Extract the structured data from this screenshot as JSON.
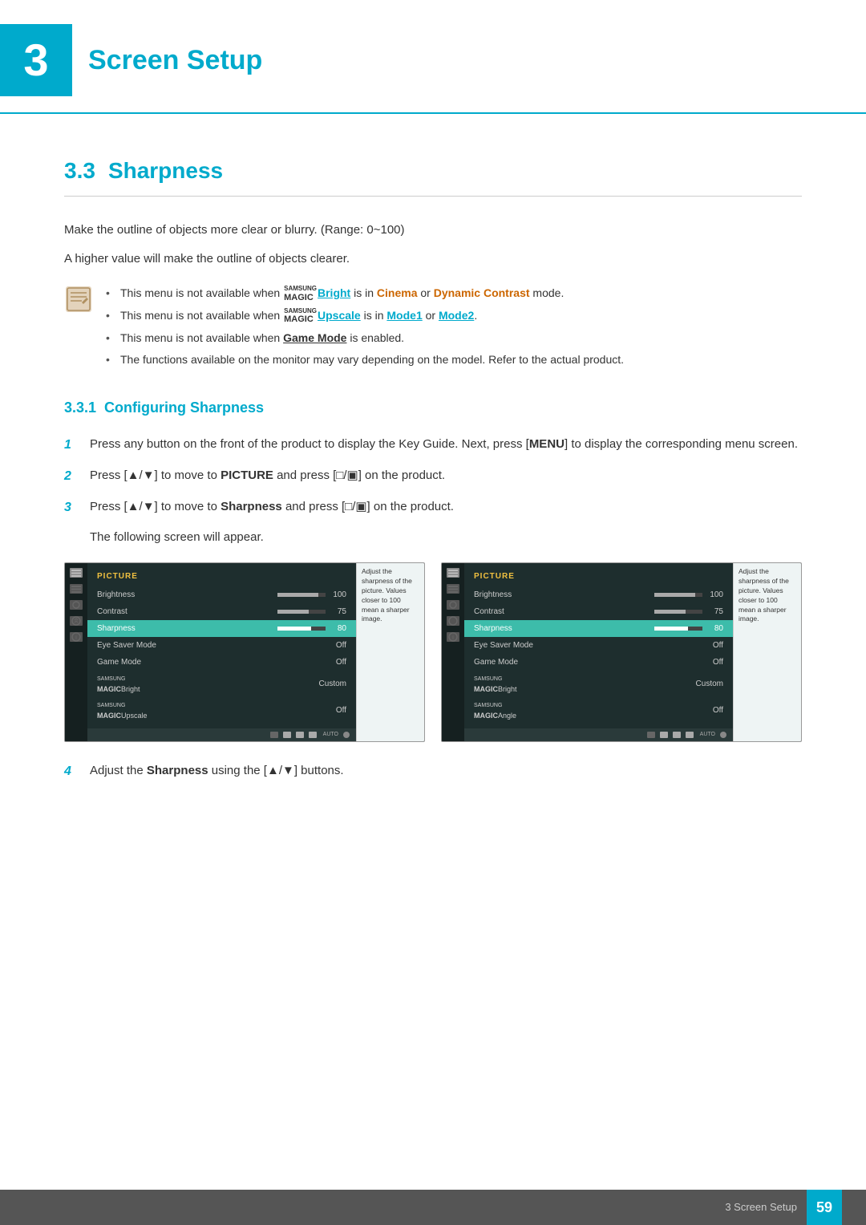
{
  "chapter": {
    "number": "3",
    "title": "Screen Setup"
  },
  "section": {
    "number": "3.3",
    "title": "Sharpness",
    "description1": "Make the outline of objects more clear or blurry. (Range: 0~100)",
    "description2": "A higher value will make the outline of objects clearer.",
    "notes": [
      {
        "id": 1,
        "parts": [
          {
            "text": "This menu is not available when ",
            "type": "normal"
          },
          {
            "text": "SAMSUNG",
            "type": "brand-top"
          },
          {
            "text": "MAGIC",
            "type": "brand-magic"
          },
          {
            "text": "Bright",
            "type": "highlight-blue"
          },
          {
            "text": " is in ",
            "type": "normal"
          },
          {
            "text": "Cinema",
            "type": "highlight-orange"
          },
          {
            "text": " or ",
            "type": "normal"
          },
          {
            "text": "Dynamic Contrast",
            "type": "highlight-orange"
          },
          {
            "text": " mode.",
            "type": "normal"
          }
        ]
      },
      {
        "id": 2,
        "parts": [
          {
            "text": "This menu is not available when ",
            "type": "normal"
          },
          {
            "text": "SAMSUNG",
            "type": "brand-top"
          },
          {
            "text": "MAGIC",
            "type": "brand-magic"
          },
          {
            "text": "Upscale",
            "type": "highlight-blue"
          },
          {
            "text": " is in ",
            "type": "normal"
          },
          {
            "text": "Mode1",
            "type": "highlight-blue"
          },
          {
            "text": " or ",
            "type": "normal"
          },
          {
            "text": "Mode2",
            "type": "highlight-blue"
          },
          {
            "text": ".",
            "type": "normal"
          }
        ]
      },
      {
        "id": 3,
        "parts": [
          {
            "text": "This menu is not available when ",
            "type": "normal"
          },
          {
            "text": "Game Mode",
            "type": "highlight-bold"
          },
          {
            "text": " is enabled.",
            "type": "normal"
          }
        ]
      },
      {
        "id": 4,
        "parts": [
          {
            "text": "The functions available on the monitor may vary depending on the model. Refer to the actual product.",
            "type": "normal"
          }
        ]
      }
    ],
    "subsection": {
      "number": "3.3.1",
      "title": "Configuring Sharpness"
    },
    "steps": [
      {
        "num": "1",
        "text": "Press any button on the front of the product to display the Key Guide. Next, press [",
        "bold_mid": "MENU",
        "text2": "] to display the corresponding menu screen."
      },
      {
        "num": "2",
        "text": "Press [▲/▼] to move to ",
        "bold_mid": "PICTURE",
        "text2": " and press [□/▣] on the product."
      },
      {
        "num": "3",
        "text": "Press [▲/▼] to move to ",
        "bold_mid": "Sharpness",
        "text2": " and press [□/▣] on the product."
      }
    ],
    "step3_subtext": "The following screen will appear.",
    "step4_text": "Adjust the ",
    "step4_bold": "Sharpness",
    "step4_text2": " using the [▲/▼] buttons."
  },
  "monitor1": {
    "header": "PICTURE",
    "items": [
      {
        "name": "Brightness",
        "value": "100",
        "bar": 85,
        "active": false
      },
      {
        "name": "Contrast",
        "value": "75",
        "bar": 65,
        "active": false
      },
      {
        "name": "Sharpness",
        "value": "80",
        "bar": 70,
        "active": true
      },
      {
        "name": "Eye Saver Mode",
        "value": "Off",
        "bar": 0,
        "active": false
      },
      {
        "name": "Game Mode",
        "value": "Off",
        "bar": 0,
        "active": false
      },
      {
        "name": "MAGICBright",
        "value": "Custom",
        "bar": 0,
        "active": false
      },
      {
        "name": "MAGICUpscale",
        "value": "Off",
        "bar": 0,
        "active": false
      }
    ],
    "tooltip": "Adjust the sharpness of the picture. Values closer to 100 mean a sharper image."
  },
  "monitor2": {
    "header": "PICTURE",
    "items": [
      {
        "name": "Brightness",
        "value": "100",
        "bar": 85,
        "active": false
      },
      {
        "name": "Contrast",
        "value": "75",
        "bar": 65,
        "active": false
      },
      {
        "name": "Sharpness",
        "value": "80",
        "bar": 70,
        "active": true
      },
      {
        "name": "Eye Saver Mode",
        "value": "Off",
        "bar": 0,
        "active": false
      },
      {
        "name": "Game Mode",
        "value": "Off",
        "bar": 0,
        "active": false
      },
      {
        "name": "MAGICBright",
        "value": "Custom",
        "bar": 0,
        "active": false
      },
      {
        "name": "MAGICAngle",
        "value": "Off",
        "bar": 0,
        "active": false
      }
    ],
    "tooltip": "Adjust the sharpness of the picture. Values closer to 100 mean a sharper image."
  },
  "footer": {
    "text": "3 Screen Setup",
    "page": "59"
  }
}
